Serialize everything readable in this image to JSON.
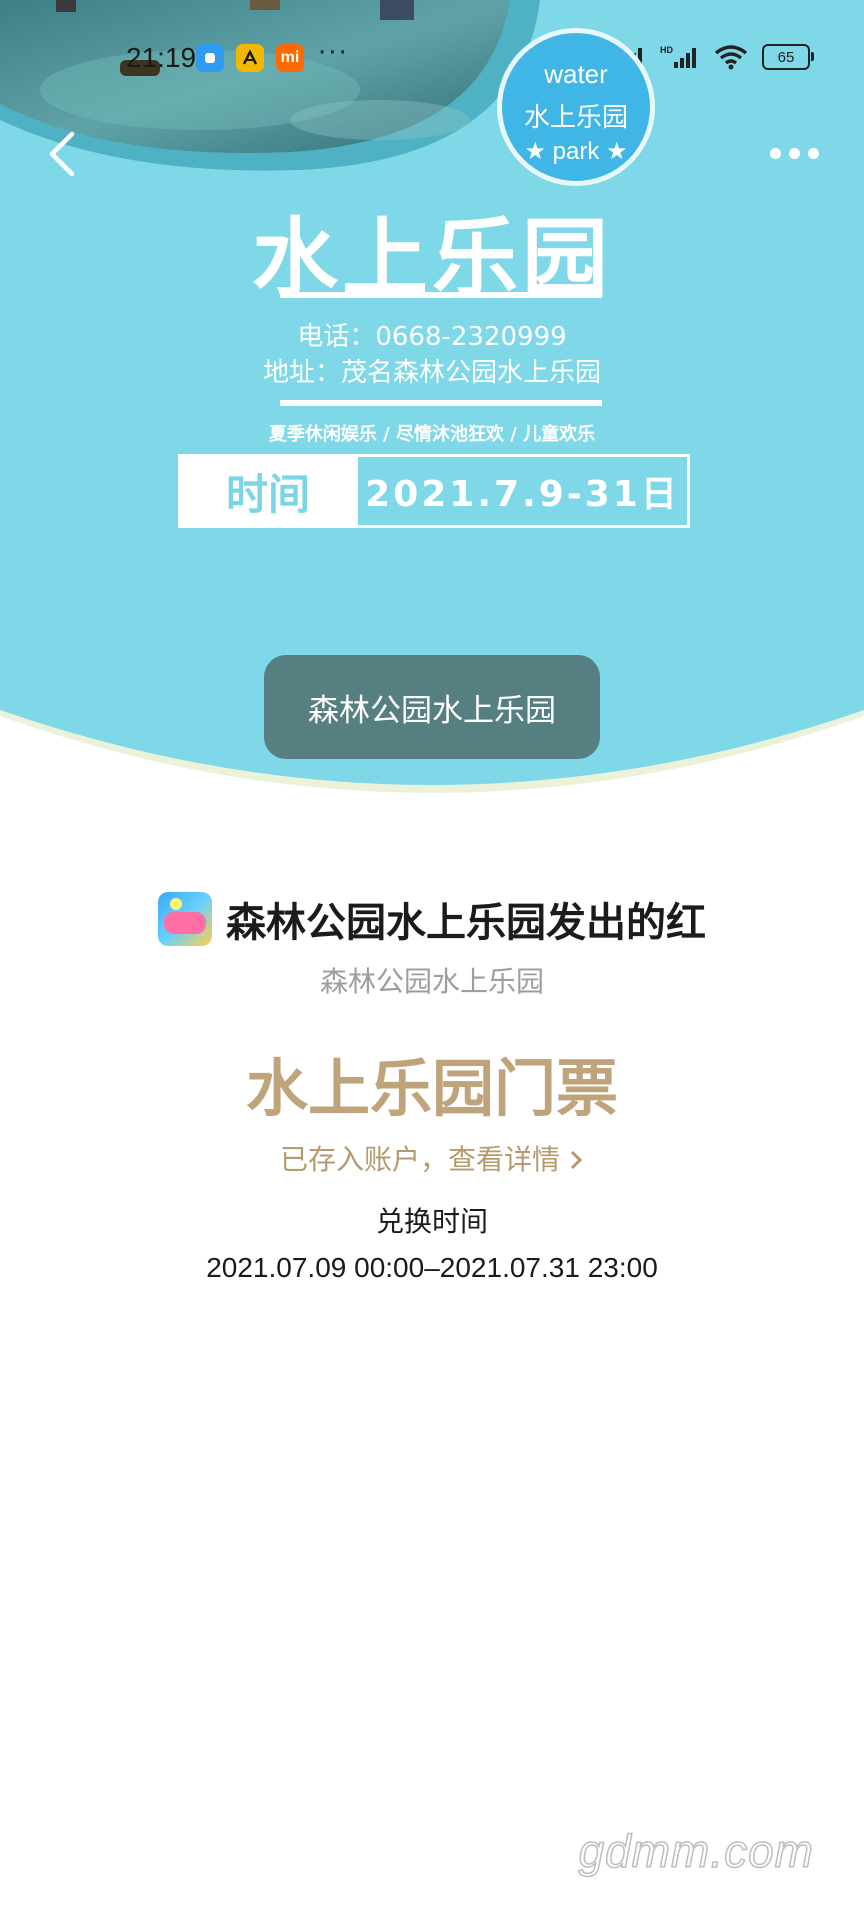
{
  "status_bar": {
    "time": "21:19",
    "app_icons": [
      "blue-square-app-icon",
      "yellow-a-app-icon",
      "mi-app-icon"
    ],
    "mi_label": "mi",
    "more": "···",
    "hd_label": "HD",
    "battery": "65"
  },
  "nav": {
    "back_icon": "chevron-left-icon",
    "more_icon": "more-dots-icon"
  },
  "poster": {
    "badge_top": "water",
    "badge_mid": "水上乐园",
    "badge_bottom": "★ park ★",
    "title": "水上乐园",
    "phone": "电话：0668-2320999",
    "address": "地址：茂名森林公园水上乐园",
    "tags": "夏季休闲娱乐 / 尽情沐池狂欢 / 儿童欢乐",
    "time_label": "时间",
    "time_value": "2021.7.9-31日",
    "colors": {
      "sky": "#7fd8e8",
      "dark_water": "#2f8fa0",
      "button": "#567f82"
    }
  },
  "park_button": "森林公园水上乐园",
  "packet": {
    "sender": "森林公园水上乐园发出的红",
    "sender_sub": "森林公园水上乐园",
    "ticket_title": "水上乐园门票",
    "saved_link": "已存入账户，查看详情",
    "redeem_label": "兑换时间",
    "redeem_range": "2021.07.09 00:00–2021.07.31 23:00",
    "colors": {
      "gold": "#bfa37a"
    }
  },
  "watermark": "gdmm.com"
}
